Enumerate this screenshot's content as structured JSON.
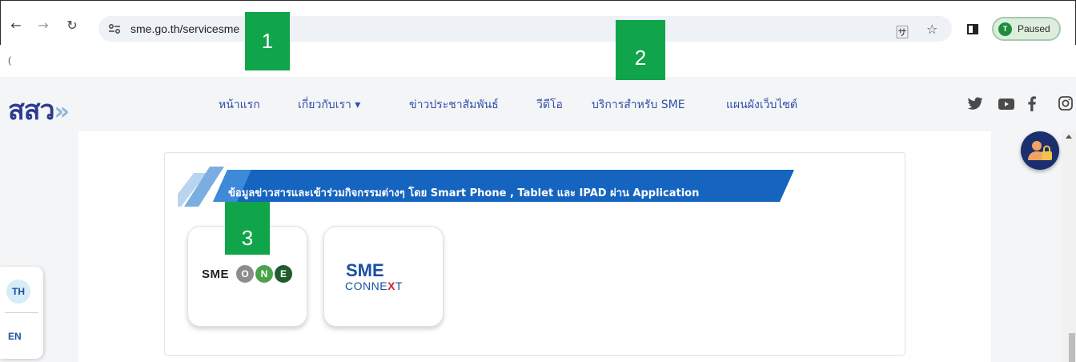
{
  "browser": {
    "url": "sme.go.th/servicesme",
    "profile_initial": "T",
    "profile_status": "Paused",
    "stray_char": "("
  },
  "site": {
    "logo_text": "สสว",
    "logo_arrow": "»",
    "menu": [
      {
        "label": "หน้าแรก"
      },
      {
        "label": "เกี่ยวกับเรา ▾"
      },
      {
        "label": "ข่าวประชาสัมพันธ์"
      },
      {
        "label": "วีดีโอ"
      },
      {
        "label": "บริการสำหรับ SME"
      },
      {
        "label": "แผนผังเว็บไซต์"
      }
    ],
    "social_icons": [
      "twitter-icon",
      "youtube-icon",
      "facebook-icon",
      "instagram-icon"
    ]
  },
  "content": {
    "banner_text": "ข้อมูลข่าวสารและเข้าร่วมกิจกรรมต่างๆ โดย Smart Phone , Tablet และ IPAD ผ่าน Application",
    "apps": [
      {
        "name": "SME ONE",
        "prefix": "SME",
        "letters": [
          "O",
          "N",
          "E"
        ]
      },
      {
        "name": "SME CONNEXT",
        "line1": "SME",
        "line2a": "CONNE",
        "line2b": "X",
        "line2c": "T"
      }
    ]
  },
  "language": {
    "th": "TH",
    "en": "EN"
  },
  "markers": [
    "1",
    "2",
    "3"
  ],
  "colors": {
    "brand_blue": "#2f3b8e",
    "menu_blue": "#2f4fa8",
    "banner_blue": "#1565c0",
    "marker_green": "#11a54b",
    "connext_red": "#d2232a"
  }
}
